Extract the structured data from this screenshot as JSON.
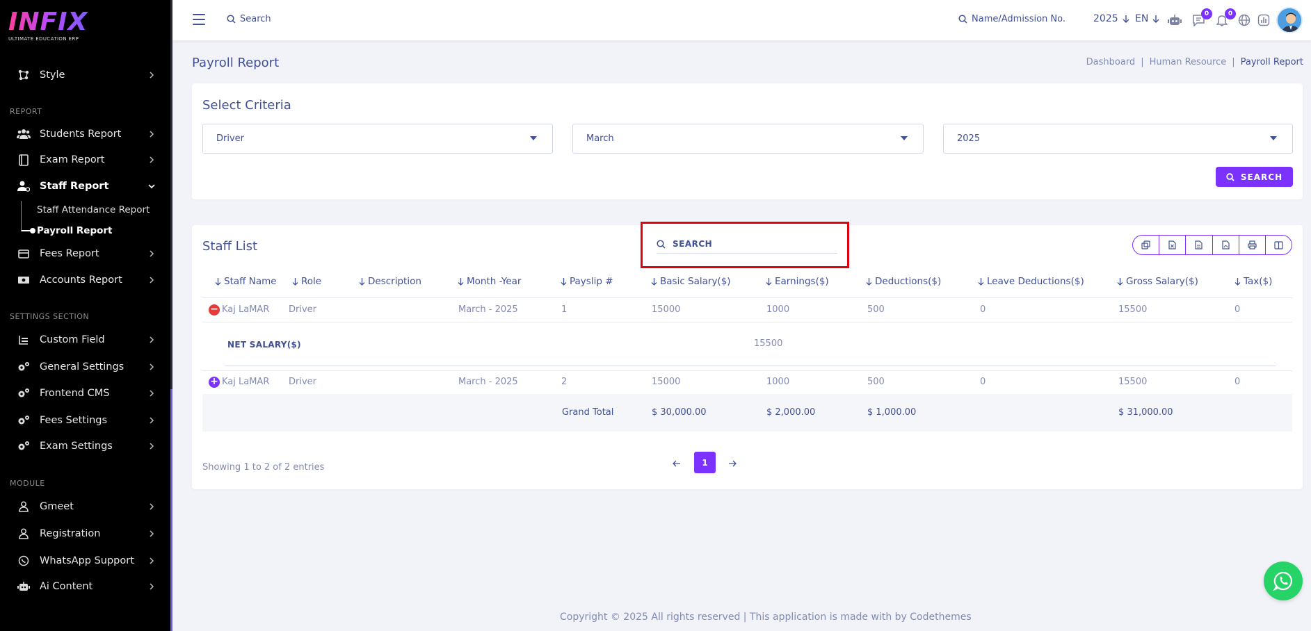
{
  "brand": {
    "logo_text": "INFIX",
    "tagline": "ULTIMATE EDUCATION ERP"
  },
  "sidebar": {
    "style_item": {
      "label": "Style",
      "icon": "style-icon"
    },
    "section_report": "REPORT",
    "report_items": [
      {
        "label": "Students Report",
        "icon": "students-icon"
      },
      {
        "label": "Exam Report",
        "icon": "exam-icon"
      },
      {
        "label": "Staff Report",
        "icon": "staff-icon"
      },
      {
        "label": "Fees Report",
        "icon": "fees-icon"
      },
      {
        "label": "Accounts Report",
        "icon": "accounts-icon"
      }
    ],
    "staff_sub": [
      {
        "label": "Staff Attendance Report"
      },
      {
        "label": "Payroll Report"
      }
    ],
    "section_settings": "SETTINGS SECTION",
    "settings_items": [
      {
        "label": "Custom Field"
      },
      {
        "label": "General Settings"
      },
      {
        "label": "Frontend CMS"
      },
      {
        "label": "Fees Settings"
      },
      {
        "label": "Exam Settings"
      }
    ],
    "section_module": "MODULE",
    "module_items": [
      {
        "label": "Gmeet"
      },
      {
        "label": "Registration"
      },
      {
        "label": "WhatsApp Support"
      },
      {
        "label": "Ai Content"
      }
    ]
  },
  "topbar": {
    "search_label": "Search",
    "admission_label": "Name/Admission No.",
    "year": "2025",
    "lang": "EN",
    "messages_count": "0",
    "notifications_count": "0"
  },
  "page": {
    "title": "Payroll Report",
    "breadcrumb": [
      "Dashboard",
      "|",
      "Human Resource",
      "|",
      "Payroll Report"
    ]
  },
  "criteria": {
    "title": "Select Criteria",
    "role": "Driver",
    "month": "March",
    "year": "2025",
    "search_button": "SEARCH"
  },
  "staff_list": {
    "title": "Staff List",
    "search_placeholder": "SEARCH",
    "columns": [
      "Staff Name",
      "Role",
      "Description",
      "Month -Year",
      "Payslip #",
      "Basic Salary($)",
      "Earnings($)",
      "Deductions($)",
      "Leave Deductions($)",
      "Gross Salary($)",
      "Tax($)"
    ],
    "rows": [
      {
        "name": "Kaj LaMAR",
        "role": "Driver",
        "description": "",
        "month_year": "March - 2025",
        "payslip": "1",
        "basic": "15000",
        "earnings": "1000",
        "deductions": "500",
        "leave": "0",
        "gross": "15500",
        "tax": "0"
      },
      {
        "name": "Kaj LaMAR",
        "role": "Driver",
        "description": "",
        "month_year": "March - 2025",
        "payslip": "2",
        "basic": "15000",
        "earnings": "1000",
        "deductions": "500",
        "leave": "0",
        "gross": "15500",
        "tax": "0"
      }
    ],
    "net_salary_label": "NET SALARY($)",
    "net_salary_value": "15500",
    "totals": {
      "label": "Grand Total",
      "basic": "$ 30,000.00",
      "earnings": "$ 2,000.00",
      "deductions": "$ 1,000.00",
      "gross": "$ 31,000.00"
    },
    "showing": "Showing 1 to 2 of 2 entries",
    "current_page": "1"
  },
  "footer": "Copyright © 2025 All rights reserved | This application is made with by Codethemes"
}
